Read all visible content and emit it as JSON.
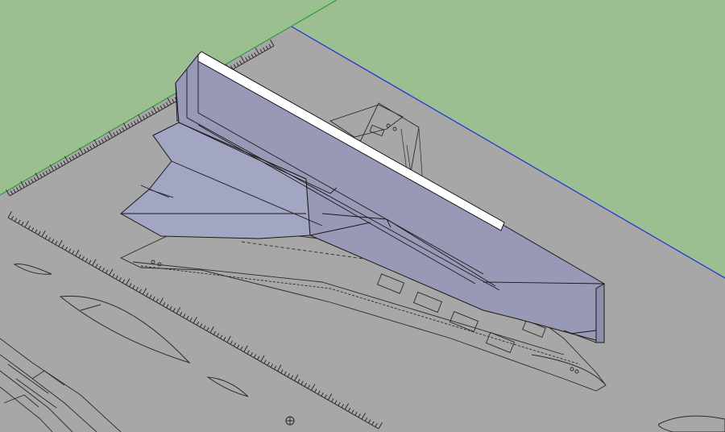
{
  "scene": {
    "colors": {
      "sky": "#9bbf90",
      "ground_plane": "#a7a7a7",
      "blueprint_lines": "#2a2a2a",
      "model_face": "#a3a6c2",
      "model_face_dark": "#9497b2",
      "model_top_edge": "#ffffff",
      "green_axis": "#2ca02c",
      "blue_axis": "#1f2fdc"
    },
    "objects": [
      "ground-plane-blueprint",
      "wing-extrusion-model",
      "ruler-scale-upper",
      "ruler-scale-lower",
      "airfoil-sections"
    ]
  }
}
